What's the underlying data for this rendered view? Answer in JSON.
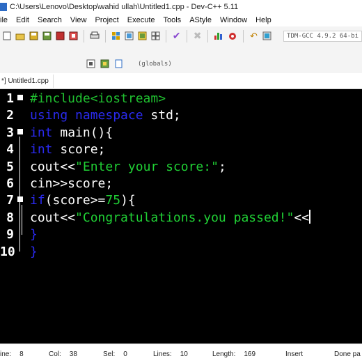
{
  "window": {
    "title": "C:\\Users\\Lenovo\\Desktop\\wahid ullah\\Untitled1.cpp - Dev-C++ 5.11"
  },
  "menu": [
    "ile",
    "Edit",
    "Search",
    "View",
    "Project",
    "Execute",
    "Tools",
    "AStyle",
    "Window",
    "Help"
  ],
  "toolbar": {
    "compiler": "TDM-GCC 4.9.2 64-bi",
    "scope": "(globals)"
  },
  "tab": {
    "label": "*] Untitled1.cpp"
  },
  "editor": {
    "lines": [
      {
        "n": "1",
        "tokens": [
          {
            "t": "#include",
            "c": "pp"
          },
          {
            "t": "<iostream>",
            "c": "pp"
          }
        ]
      },
      {
        "n": "2",
        "tokens": [
          {
            "t": "using",
            "c": "kw"
          },
          {
            "t": " ",
            "c": "txt"
          },
          {
            "t": "namespace",
            "c": "kw"
          },
          {
            "t": " std;",
            "c": "txt"
          }
        ]
      },
      {
        "n": "3",
        "tokens": [
          {
            "t": "int",
            "c": "kw"
          },
          {
            "t": " main(){",
            "c": "txt"
          }
        ]
      },
      {
        "n": "4",
        "tokens": [
          {
            "t": "int",
            "c": "kw"
          },
          {
            "t": " score;",
            "c": "txt"
          }
        ]
      },
      {
        "n": "5",
        "tokens": [
          {
            "t": "cout<<",
            "c": "txt"
          },
          {
            "t": "\"Enter your score:\"",
            "c": "str"
          },
          {
            "t": ";",
            "c": "txt"
          }
        ]
      },
      {
        "n": "6",
        "tokens": [
          {
            "t": "cin>>score;",
            "c": "txt"
          }
        ]
      },
      {
        "n": "7",
        "tokens": [
          {
            "t": "if",
            "c": "kw"
          },
          {
            "t": "(score>=",
            "c": "txt"
          },
          {
            "t": "75",
            "c": "num"
          },
          {
            "t": "){",
            "c": "txt"
          }
        ]
      },
      {
        "n": "8",
        "tokens": [
          {
            "t": "cout<<",
            "c": "txt"
          },
          {
            "t": "\"Congratulations.you passed!\"",
            "c": "str"
          },
          {
            "t": "<<",
            "c": "txt"
          }
        ]
      },
      {
        "n": "9",
        "tokens": [
          {
            "t": "}",
            "c": "kw"
          }
        ]
      },
      {
        "n": "10",
        "tokens": [
          {
            "t": "}",
            "c": "kw"
          }
        ]
      }
    ]
  },
  "status": {
    "line_label": "ine:",
    "line_value": "8",
    "col_label": "Col:",
    "col_value": "38",
    "sel_label": "Sel:",
    "sel_value": "0",
    "lines_label": "Lines:",
    "lines_value": "10",
    "length_label": "Length:",
    "length_value": "169",
    "mode": "Insert",
    "message": "Done pa"
  },
  "colors": {
    "keyword": "#2a2af0",
    "string": "#20d035",
    "background": "#000000"
  }
}
